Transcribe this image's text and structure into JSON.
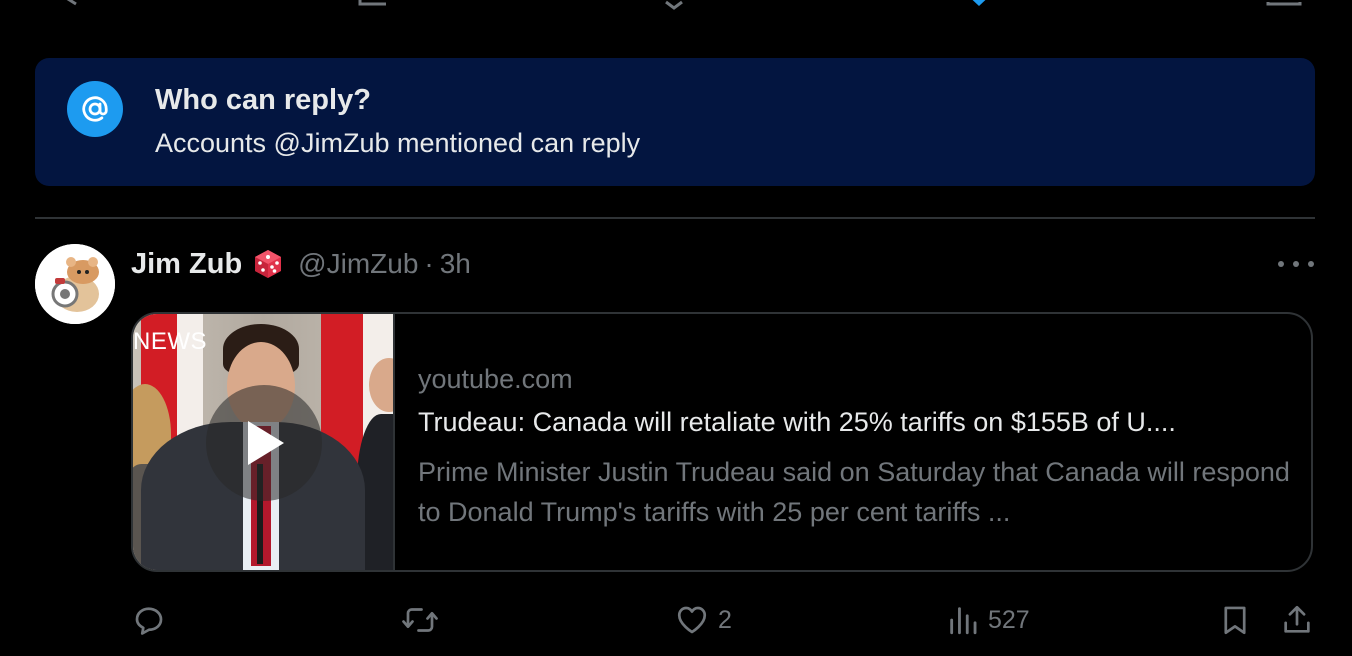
{
  "colors": {
    "background": "#000000",
    "banner_bg": "#031540",
    "accent": "#1d9bf0",
    "text_primary": "#e7e9ea",
    "text_secondary": "#71767b",
    "border": "#2f3336"
  },
  "reply_restriction": {
    "icon": "at-sign-icon",
    "title": "Who can reply?",
    "subtitle": "Accounts @JimZub mentioned can reply"
  },
  "tweet": {
    "author_name": "Jim Zub",
    "author_badge_icon": "dice-icon",
    "handle": "@JimZub",
    "separator": "·",
    "time": "3h",
    "link_card": {
      "thumbnail_label": "NEWS",
      "domain": "youtube.com",
      "title": "Trudeau: Canada will retaliate with 25% tariffs on $155B of U....",
      "description": "Prime Minister Justin Trudeau said on Saturday that Canada will respond to Donald Trump's tariffs with 25 per cent tariffs ..."
    },
    "actions": {
      "reply_count": "",
      "retweet_count": "",
      "like_count": "2",
      "views_count": "527"
    }
  }
}
